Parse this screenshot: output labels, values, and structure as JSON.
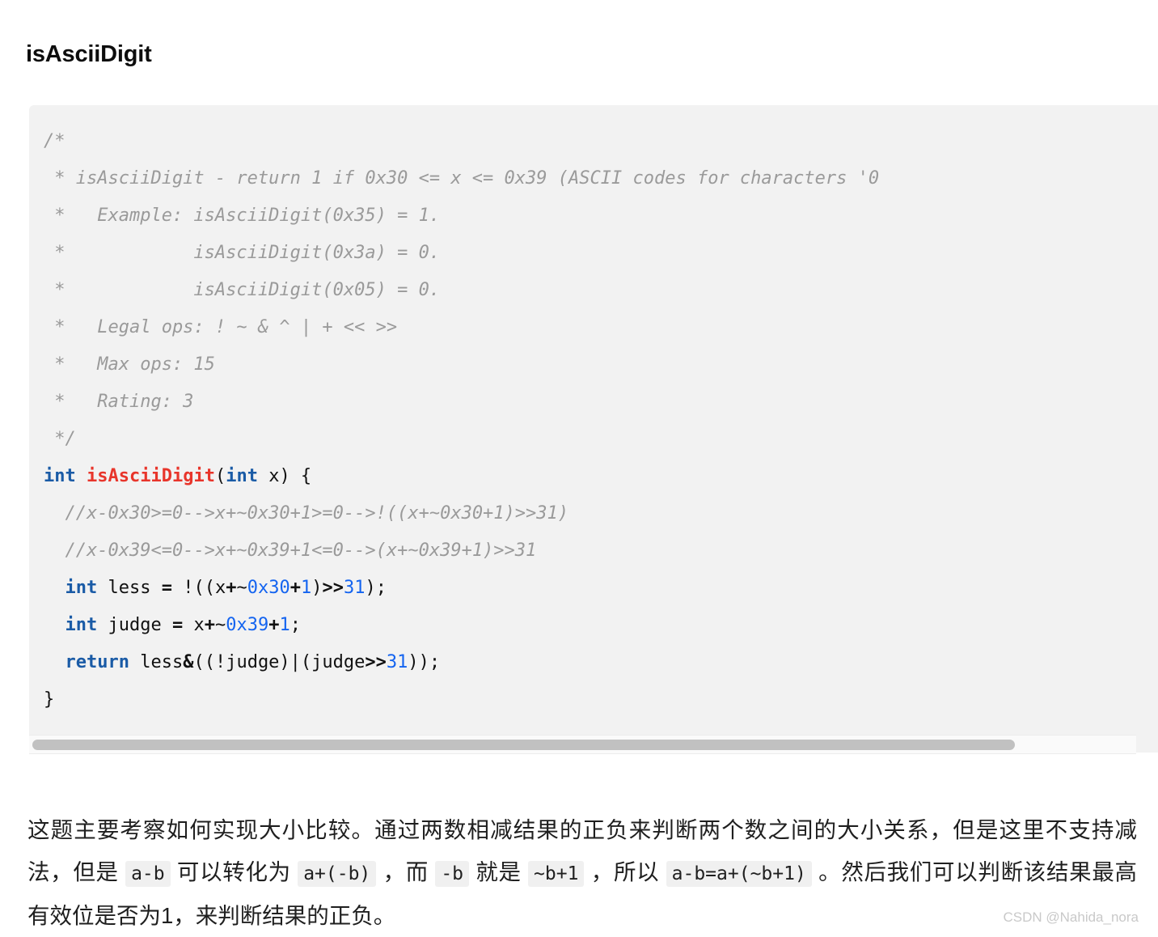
{
  "page": {
    "title": "isAsciiDigit",
    "background_color": "#ffffff"
  },
  "code_block": {
    "background_color": "#f2f2f2",
    "language": "c",
    "comment_color": "#9a9a9a",
    "keyword_color": "#1a5ba6",
    "function_color": "#e8352b",
    "number_color": "#1464f0",
    "overflow_clipped": true,
    "lines": [
      "/*",
      " * isAsciiDigit - return 1 if 0x30 <= x <= 0x39 (ASCII codes for characters '0",
      " *   Example: isAsciiDigit(0x35) = 1.",
      " *            isAsciiDigit(0x3a) = 0.",
      " *            isAsciiDigit(0x05) = 0.",
      " *   Legal ops: ! ~ & ^ | + << >>",
      " *   Max ops: 15",
      " *   Rating: 3",
      " */",
      "int isAsciiDigit(int x) {",
      "  //x-0x30>=0-->x+~0x30+1>=0-->!((x+~0x30+1)>>31)",
      "  //x-0x39<=0-->x+~0x39+1<=0-->(x+~0x39+1)>>31",
      "  int less = !((x+~0x30+1)>>31);",
      "  int judge = x+~0x39+1;",
      "  return less&((!judge)|(judge>>31));",
      "}"
    ],
    "tokens": {
      "kw_int": "int",
      "kw_return": "return",
      "fn_name": "isAsciiDigit",
      "num_0x30": "0x30",
      "num_0x39": "0x39",
      "num_1": "1",
      "num_31": "31"
    }
  },
  "scrollbar": {
    "orientation": "horizontal",
    "track_color": "#fafafa",
    "thumb_color": "#c1c1c1",
    "thumb_position_percent": 0
  },
  "body": {
    "paragraph_parts": [
      {
        "type": "text",
        "value": "这题主要考察如何实现大小比较。通过两数相减结果的正负来判断两个数之间的大小关系，但是这里不支持减法，但是 "
      },
      {
        "type": "code",
        "value": "a-b"
      },
      {
        "type": "text",
        "value": " 可以转化为 "
      },
      {
        "type": "code",
        "value": "a+(-b)"
      },
      {
        "type": "text",
        "value": " ，而 "
      },
      {
        "type": "code",
        "value": "-b"
      },
      {
        "type": "text",
        "value": " 就是 "
      },
      {
        "type": "code",
        "value": "~b+1"
      },
      {
        "type": "text",
        "value": " ，所以 "
      },
      {
        "type": "code",
        "value": "a-b=a+(~b+1)"
      },
      {
        "type": "text",
        "value": " 。然后我们可以判断该结果最高有效位是否为1，来判断结果的正负。"
      }
    ]
  },
  "watermark": {
    "text": "CSDN @Nahida_nora"
  }
}
